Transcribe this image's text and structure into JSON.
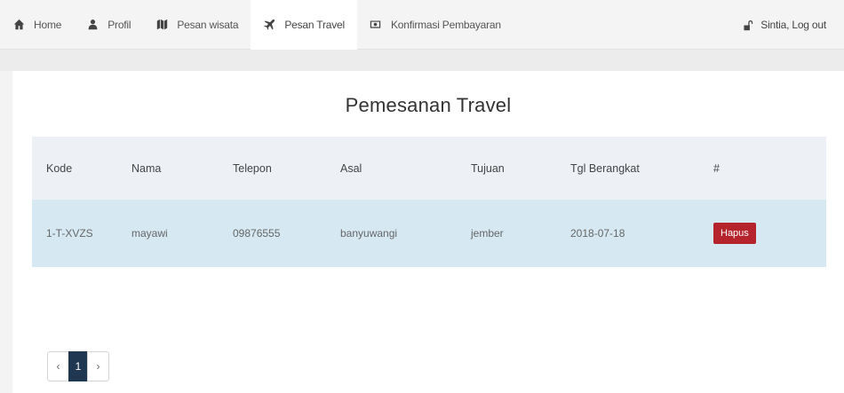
{
  "nav": {
    "items": [
      {
        "label": "Home",
        "icon": "home-icon"
      },
      {
        "label": "Profil",
        "icon": "user-icon"
      },
      {
        "label": "Pesan wisata",
        "icon": "map-icon"
      },
      {
        "label": "Pesan Travel",
        "icon": "plane-icon"
      },
      {
        "label": "Konfirmasi Pembayaran",
        "icon": "money-icon"
      }
    ],
    "active_index": 3,
    "user_label": "Sintia, Log out",
    "user_icon": "unlock-icon"
  },
  "page": {
    "title": "Pemesanan Travel"
  },
  "table": {
    "headers": [
      "Kode",
      "Nama",
      "Telepon",
      "Asal",
      "Tujuan",
      "Tgl Berangkat",
      "#"
    ],
    "rows": [
      {
        "kode": "1-T-XVZS",
        "nama": "mayawi",
        "telepon": "09876555",
        "asal": "banyuwangi",
        "tujuan": "jember",
        "tgl": "2018-07-18",
        "action": "Hapus"
      }
    ]
  },
  "pagination": {
    "prev": "‹",
    "current": "1",
    "next": "›"
  },
  "colors": {
    "danger": "#b5242c",
    "pager_active": "#1f3750",
    "row_highlight": "#d6e9f3"
  }
}
